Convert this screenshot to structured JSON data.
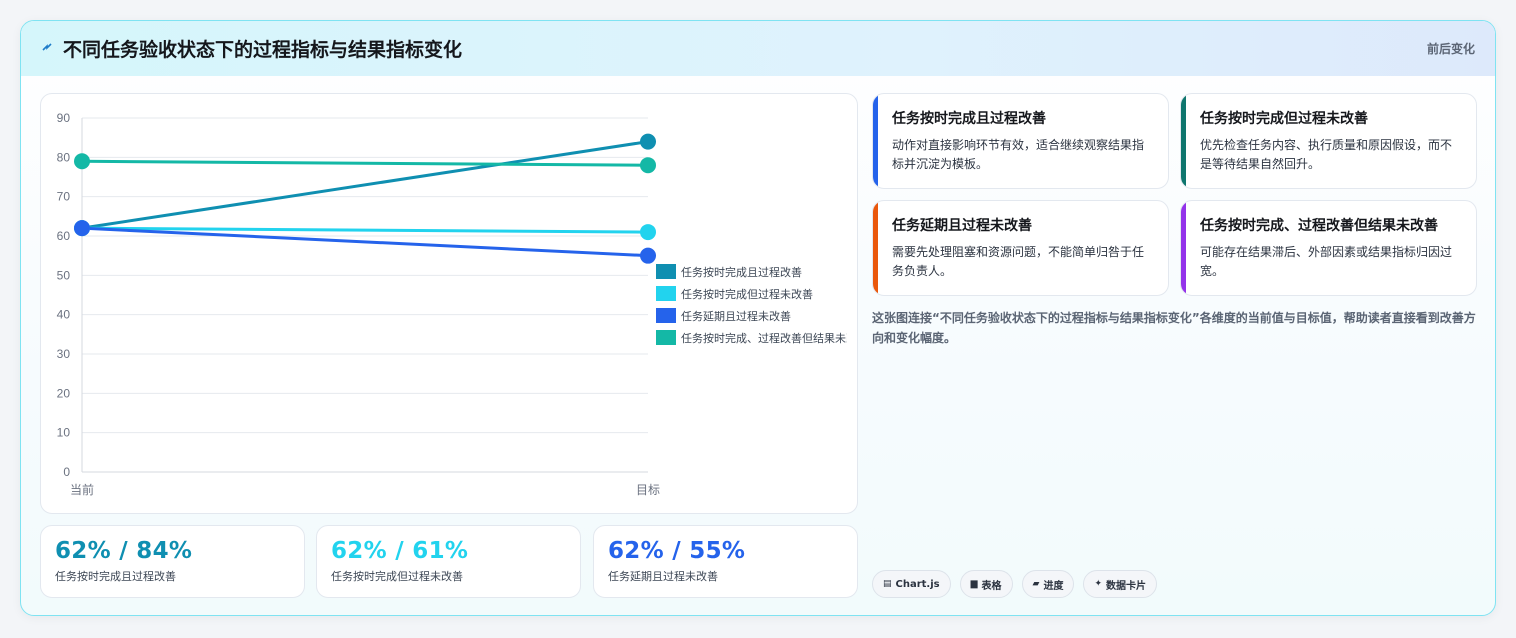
{
  "header": {
    "title": "不同任务验收状态下的过程指标与结果指标变化",
    "tag": "前后变化"
  },
  "colors": {
    "s1": "#0f8fb1",
    "s2": "#22d3ee",
    "s3": "#2563eb",
    "s4": "#14b8a6"
  },
  "chart_data": {
    "type": "line",
    "categories": [
      "当前",
      "目标"
    ],
    "ylim": [
      0,
      90
    ],
    "yticks": [
      0,
      10,
      20,
      30,
      40,
      50,
      60,
      70,
      80,
      90
    ],
    "grid": true,
    "legend_position": "right",
    "series": [
      {
        "name": "任务按时完成且过程改善",
        "values": [
          62,
          84
        ],
        "color": "#0f8fb1"
      },
      {
        "name": "任务按时完成但过程未改善",
        "values": [
          62,
          61
        ],
        "color": "#22d3ee"
      },
      {
        "name": "任务延期且过程未改善",
        "values": [
          62,
          55
        ],
        "color": "#2563eb"
      },
      {
        "name": "任务按时完成、过程改善但结果未改善",
        "values": [
          79,
          78
        ],
        "color": "#14b8a6"
      }
    ]
  },
  "stats": [
    {
      "value": "62% / 84%",
      "label": "任务按时完成且过程改善",
      "color": "#0f8fb1"
    },
    {
      "value": "62% / 61%",
      "label": "任务按时完成但过程未改善",
      "color": "#22d3ee"
    },
    {
      "value": "62% / 55%",
      "label": "任务延期且过程未改善",
      "color": "#2563eb"
    }
  ],
  "insights": [
    {
      "title": "任务按时完成且过程改善",
      "desc": "动作对直接影响环节有效，适合继续观察结果指标并沉淀为模板。",
      "color": "#2563eb"
    },
    {
      "title": "任务按时完成但过程未改善",
      "desc": "优先检查任务内容、执行质量和原因假设，而不是等待结果自然回升。",
      "color": "#0f766e"
    },
    {
      "title": "任务延期且过程未改善",
      "desc": "需要先处理阻塞和资源问题，不能简单归咎于任务负责人。",
      "color": "#ea580c"
    },
    {
      "title": "任务按时完成、过程改善但结果未改善",
      "desc": "可能存在结果滞后、外部因素或结果指标归因过宽。",
      "color": "#9333ea"
    }
  ],
  "description": "这张图连接“不同任务验收状态下的过程指标与结果指标变化”各维度的当前值与目标值，帮助读者直接看到改善方向和变化幅度。",
  "chips": [
    {
      "icon": "chart-icon",
      "label": "Chart.js"
    },
    {
      "icon": "table-icon",
      "label": "表格"
    },
    {
      "icon": "progress-icon",
      "label": "进度"
    },
    {
      "icon": "sparkle-icon",
      "label": "数据卡片"
    }
  ]
}
